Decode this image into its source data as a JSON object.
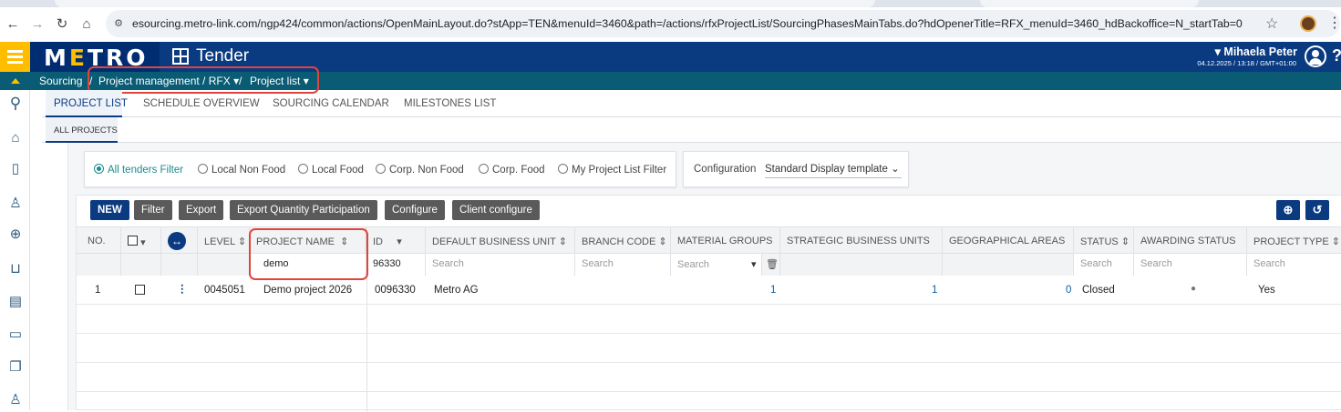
{
  "browser": {
    "url": "esourcing.metro-link.com/ngp424/common/actions/OpenMainLayout.do?stApp=TEN&menuId=3460&path=/actions/rfxProjectList/SourcingPhasesMainTabs.do?hdOpenerTitle=RFX_menuId=3460_hdBackoffice=N_startTab=0",
    "icons": [
      "back-icon",
      "forward-icon",
      "reload-icon",
      "home-icon",
      "site-settings-icon",
      "bookmark-star-icon",
      "profile-icon",
      "menu-kebab-icon"
    ]
  },
  "header": {
    "logo": "METRO",
    "module_title": "Tender",
    "user_name": "Mihaela Peter",
    "user_meta": "04.12.2025 / 13:18 / GMT+01:00",
    "help": "?",
    "colors": {
      "navy": "#002d72",
      "yellow": "#ffbd00",
      "teal": "#0a5c74"
    }
  },
  "breadcrumb": {
    "root": "Sourcing",
    "separator": "/",
    "level1": "Project management / RFX",
    "separator2": "/",
    "level2": "Project list"
  },
  "tabs": [
    "PROJECT LIST",
    "SCHEDULE OVERVIEW",
    "SOURCING CALENDAR",
    "MILESTONES LIST"
  ],
  "subtab": "ALL PROJECTS",
  "filters": {
    "options": [
      "All tenders Filter",
      "Local Non Food",
      "Local Food",
      "Corp. Non Food",
      "Corp. Food",
      "My Project List Filter"
    ],
    "selected": "All tenders Filter"
  },
  "configuration": {
    "label": "Configuration",
    "value": "Standard Display template"
  },
  "toolbar": {
    "new": "NEW",
    "filter": "Filter",
    "export": "Export",
    "export_qty": "Export Quantity Participation",
    "configure": "Configure",
    "client_configure": "Client configure"
  },
  "table": {
    "columns": [
      "NO.",
      "LEVEL",
      "PROJECT NAME",
      "ID",
      "DEFAULT BUSINESS UNIT",
      "BRANCH CODE",
      "MATERIAL GROUPS",
      "STRATEGIC BUSINESS UNITS",
      "GEOGRAPHICAL AREAS",
      "STATUS",
      "AWARDING STATUS",
      "PROJECT TYPE"
    ],
    "search": {
      "project_name": "demo",
      "id": "96330",
      "placeholder": "Search"
    },
    "rows": [
      {
        "no": "1",
        "level": "0045051",
        "project_name": "Demo project 2026",
        "id": "0096330",
        "business_unit": "Metro AG",
        "material_groups": "1",
        "strategic_units": "1",
        "geo_areas": "0",
        "status": "Closed",
        "awarding_status": "●",
        "project_type": "Yes"
      }
    ]
  }
}
